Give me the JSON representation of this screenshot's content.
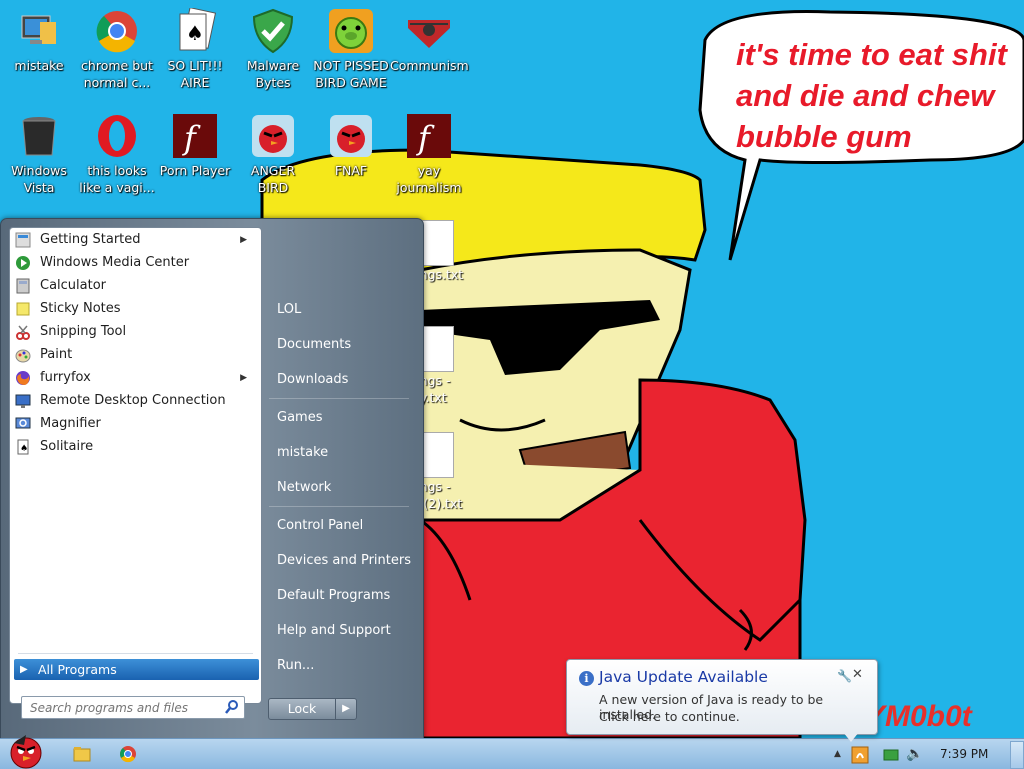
{
  "desktop": {
    "icons": [
      {
        "label": "mistake",
        "icon": "monitor-folder-icon"
      },
      {
        "label": "chrome but normal c...",
        "icon": "chrome-icon"
      },
      {
        "label": "SO LIT!!! AIRE",
        "icon": "solitaire-icon"
      },
      {
        "label": "Malware Bytes",
        "icon": "shield-check-icon"
      },
      {
        "label": "NOT PISSED BIRD GAME",
        "icon": "green-pig-icon"
      },
      {
        "label": "Communism",
        "icon": "hammer-sickle-icon"
      },
      {
        "label": "Windows Vista",
        "icon": "recycle-bin-icon"
      },
      {
        "label": "this looks like a vagi...",
        "icon": "opera-icon"
      },
      {
        "label": "Porn Player",
        "icon": "flash-icon"
      },
      {
        "label": "ANGER BIRD",
        "icon": "angry-bird-icon"
      },
      {
        "label": "FNAF",
        "icon": "angry-bird-icon"
      },
      {
        "label": "yay journalism",
        "icon": "flash-icon"
      }
    ],
    "partial_files": [
      "ongs.txt",
      "ongs -",
      "py.txt",
      "ongs -",
      "y (2).txt"
    ],
    "speech_bubble": "it's time to eat shit and die and chew bubble gum",
    "watermark": "YM0b0t"
  },
  "start_menu": {
    "programs": [
      {
        "label": "Getting Started",
        "icon": "getting-started-icon",
        "has_submenu": true
      },
      {
        "label": "Windows Media Center",
        "icon": "media-center-icon",
        "has_submenu": false
      },
      {
        "label": "Calculator",
        "icon": "calculator-icon",
        "has_submenu": false
      },
      {
        "label": "Sticky Notes",
        "icon": "sticky-notes-icon",
        "has_submenu": false
      },
      {
        "label": "Snipping Tool",
        "icon": "scissors-icon",
        "has_submenu": false
      },
      {
        "label": "Paint",
        "icon": "paint-icon",
        "has_submenu": false
      },
      {
        "label": "furryfox",
        "icon": "firefox-icon",
        "has_submenu": true
      },
      {
        "label": "Remote Desktop Connection",
        "icon": "remote-desktop-icon",
        "has_submenu": false
      },
      {
        "label": "Magnifier",
        "icon": "magnifier-icon",
        "has_submenu": false
      },
      {
        "label": "Solitaire",
        "icon": "solitaire-icon",
        "has_submenu": false
      }
    ],
    "all_programs": "All Programs",
    "search_placeholder": "Search programs and files",
    "right_items": [
      "LOL",
      "Documents",
      "Downloads",
      "Games",
      "mistake",
      "Network",
      "Control Panel",
      "Devices and Printers",
      "Default Programs",
      "Help and Support",
      "Run..."
    ],
    "lock_label": "Lock"
  },
  "taskbar": {
    "clock": "7:39 PM",
    "pinned": [
      "angry-bird-start-orb",
      "explorer-folder-icon",
      "chrome-icon"
    ]
  },
  "notification": {
    "title": "Java Update Available",
    "line1": "A new version of Java is ready to be installed.",
    "line2": "Click here to continue."
  }
}
